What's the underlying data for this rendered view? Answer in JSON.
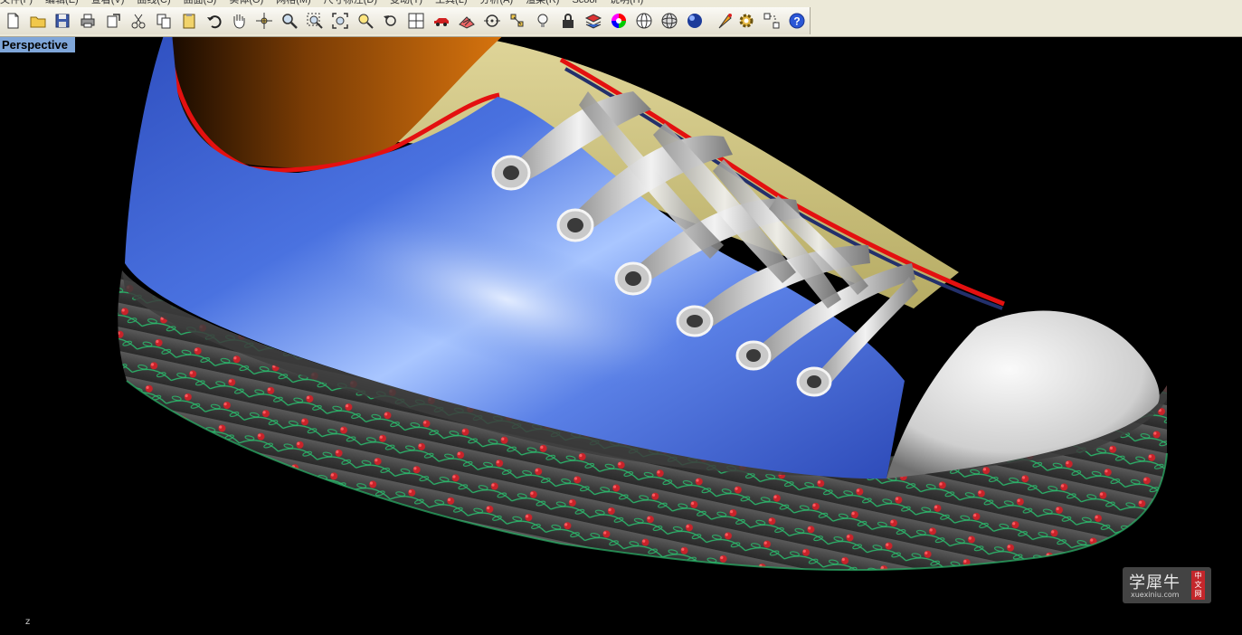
{
  "app": {
    "menu_items": [
      "文件(F)",
      "编辑(E)",
      "查看(V)",
      "曲线(C)",
      "曲面(S)",
      "实体(O)",
      "网格(M)",
      "尺寸标注(D)",
      "变动(T)",
      "工具(L)",
      "分析(A)",
      "渲染(R)",
      "Scool",
      "说明(H)"
    ]
  },
  "toolbar": {
    "buttons": [
      {
        "name": "new-file-icon"
      },
      {
        "name": "open-folder-icon"
      },
      {
        "name": "save-icon"
      },
      {
        "name": "print-icon"
      },
      {
        "name": "export-icon"
      },
      {
        "name": "cut-icon"
      },
      {
        "name": "copy-icon"
      },
      {
        "name": "paste-icon"
      },
      {
        "name": "undo-icon"
      },
      {
        "name": "pan-hand-icon"
      },
      {
        "name": "rotate-view-icon"
      },
      {
        "name": "zoom-icon"
      },
      {
        "name": "zoom-window-icon"
      },
      {
        "name": "zoom-extents-icon"
      },
      {
        "name": "zoom-selected-icon"
      },
      {
        "name": "undo-view-icon"
      },
      {
        "name": "four-viewports-icon"
      },
      {
        "name": "car-icon"
      },
      {
        "name": "grid-plane-icon"
      },
      {
        "name": "osnap-icon"
      },
      {
        "name": "points-icon"
      },
      {
        "name": "light-bulb-icon"
      },
      {
        "name": "lock-icon"
      },
      {
        "name": "layer-icon"
      },
      {
        "name": "color-wheel-icon"
      },
      {
        "name": "sphere-wire-icon"
      },
      {
        "name": "globe-icon"
      },
      {
        "name": "shaded-sphere-icon"
      },
      {
        "name": "pointer-icon"
      },
      {
        "name": "settings-gear-icon"
      },
      {
        "name": "group-icon"
      },
      {
        "name": "help-icon"
      }
    ]
  },
  "viewport": {
    "title": "Perspective",
    "axis_label": "z"
  },
  "watermark": {
    "main": "学犀牛",
    "url": "xuexiniu.com",
    "badge": "中文网"
  },
  "colors": {
    "upper_blue": "#3a5fcf",
    "lining_orange": "#c8670c",
    "tongue_khaki": "#c9c07a",
    "toe_cap": "#d9d9d9",
    "sole_dark": "#444444",
    "trim_red": "#e41010",
    "sole_pattern_green": "#2bb56a",
    "sole_pattern_red": "#c8232a"
  }
}
